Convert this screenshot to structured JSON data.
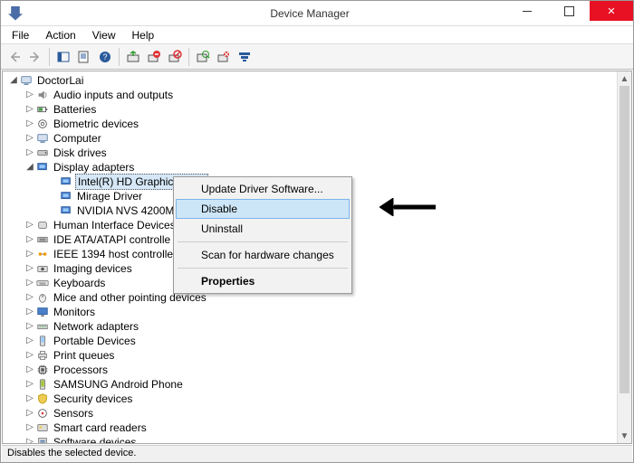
{
  "window": {
    "title": "Device Manager"
  },
  "menu": {
    "file": "File",
    "action": "Action",
    "view": "View",
    "help": "Help"
  },
  "tree": {
    "root": "DoctorLai",
    "nodes": [
      {
        "label": "Audio inputs and outputs",
        "exp": "▷"
      },
      {
        "label": "Batteries",
        "exp": "▷"
      },
      {
        "label": "Biometric devices",
        "exp": "▷"
      },
      {
        "label": "Computer",
        "exp": "▷"
      },
      {
        "label": "Disk drives",
        "exp": "▷"
      },
      {
        "label": "Display adapters",
        "exp": "◢",
        "children": [
          {
            "label": "Intel(R) HD Graphics 3000",
            "selected": true
          },
          {
            "label": "Mirage Driver"
          },
          {
            "label": "NVIDIA NVS 4200M"
          }
        ]
      },
      {
        "label": "Human Interface Devices",
        "exp": "▷"
      },
      {
        "label": "IDE ATA/ATAPI controllers",
        "exp": "▷",
        "trunc": "IDE ATA/ATAPI controlle"
      },
      {
        "label": "IEEE 1394 host controllers",
        "exp": "▷"
      },
      {
        "label": "Imaging devices",
        "exp": "▷"
      },
      {
        "label": "Keyboards",
        "exp": "▷"
      },
      {
        "label": "Mice and other pointing devices",
        "exp": "▷"
      },
      {
        "label": "Monitors",
        "exp": "▷"
      },
      {
        "label": "Network adapters",
        "exp": "▷"
      },
      {
        "label": "Portable Devices",
        "exp": "▷"
      },
      {
        "label": "Print queues",
        "exp": "▷"
      },
      {
        "label": "Processors",
        "exp": "▷"
      },
      {
        "label": "SAMSUNG Android Phone",
        "exp": "▷"
      },
      {
        "label": "Security devices",
        "exp": "▷"
      },
      {
        "label": "Sensors",
        "exp": "▷"
      },
      {
        "label": "Smart card readers",
        "exp": "▷"
      },
      {
        "label": "Software devices",
        "exp": "▷"
      }
    ]
  },
  "context_menu": {
    "update": "Update Driver Software...",
    "disable": "Disable",
    "uninstall": "Uninstall",
    "scan": "Scan for hardware changes",
    "properties": "Properties"
  },
  "status": "Disables the selected device."
}
